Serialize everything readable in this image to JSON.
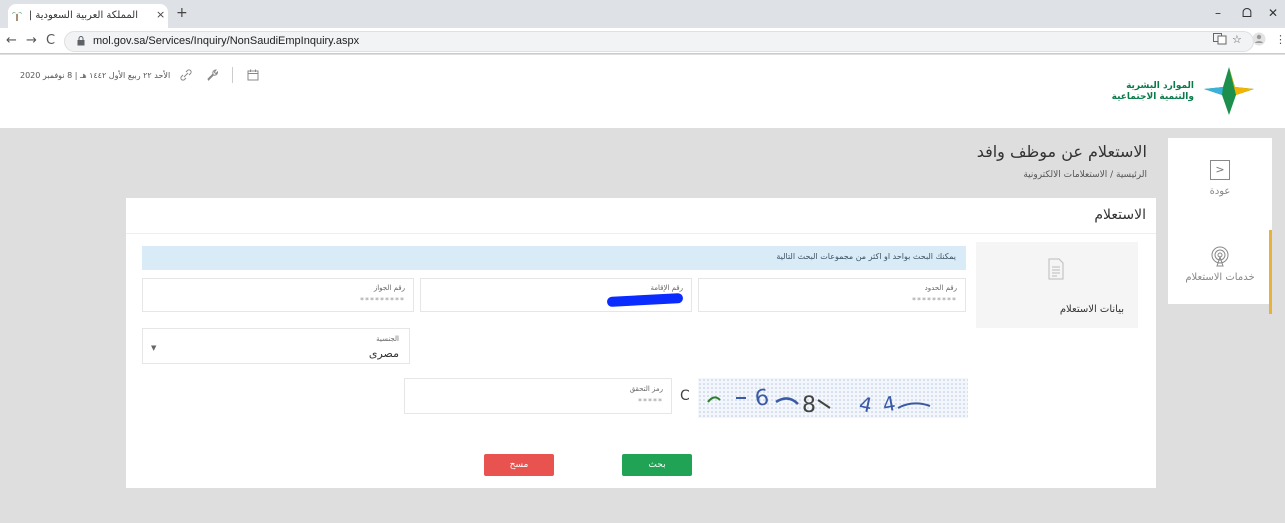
{
  "browser": {
    "tab_title": "المملكة العربية السعودية | وزارة الـ",
    "tab_close": "×",
    "new_tab": "+",
    "url": "mol.gov.sa/Services/Inquiry/NonSaudiEmpInquiry.aspx",
    "nav": {
      "back": "←",
      "forward": "→",
      "reload": "C"
    },
    "window": {
      "minimize": "–",
      "maximize": "ᗝ",
      "close": "✕"
    },
    "icons": [
      "translate-icon",
      "star-icon",
      "profile-icon",
      "menu-icon"
    ]
  },
  "header": {
    "date_text": "الأحد ٢٢ ربيع الأول ١٤٤٢ هـ | 8 نوفمبر 2020",
    "logo_line1": "الموارد البشرية",
    "logo_line2": "والتنمية الاجتماعية"
  },
  "side": {
    "back_label": "عودة",
    "back_arrow": ">",
    "services_label": "خدمات الاستعلام"
  },
  "page": {
    "title": "الاستعلام عن موظف وافد",
    "breadcrumb": "الرئيسية / الاستعلامات الالكترونية"
  },
  "card": {
    "title": "الاستعلام",
    "data_panel_label": "بيانات الاستعلام",
    "info": "يمكنك البحث بواحد او اكثر من مجموعات البحث التالية",
    "fields": [
      {
        "label": "رقم الحدود",
        "value": "*********"
      },
      {
        "label": "رقم الإقامة",
        "value": ""
      },
      {
        "label": "رقم الجواز",
        "value": "*********"
      }
    ],
    "nationality": {
      "label": "الجنسية",
      "value": "مصرى",
      "caret": "▼"
    },
    "captcha": {
      "label": "رمز التحقق",
      "value": "*****",
      "refresh": "C"
    },
    "buttons": {
      "search": "بحث",
      "clear": "مسح"
    }
  },
  "colors": {
    "search": "#21a356",
    "clear": "#e9534f",
    "accent": "#e8b23a",
    "info_bg": "#d9ebf7"
  }
}
